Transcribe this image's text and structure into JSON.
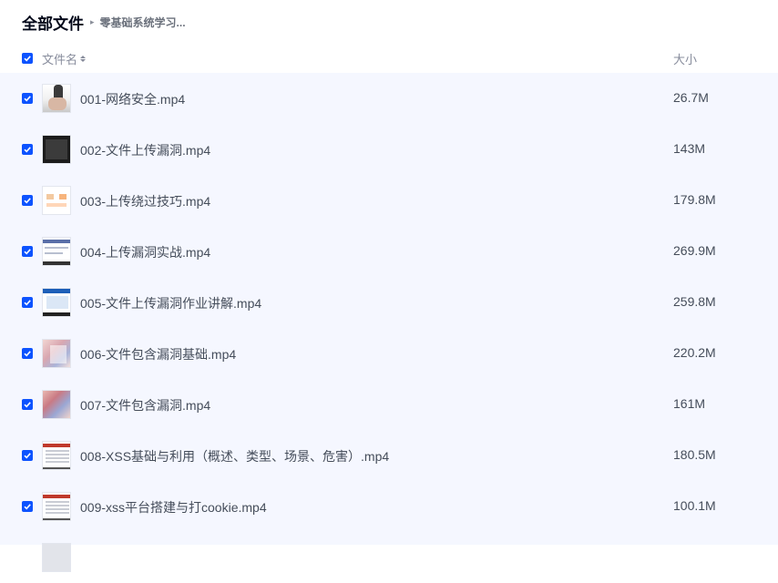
{
  "breadcrumb": {
    "root": "全部文件",
    "separator": "▸",
    "current": "零基础系统学习..."
  },
  "header": {
    "name_label": "文件名",
    "size_label": "大小",
    "select_all_checked": true
  },
  "colors": {
    "accent": "#0d53ff",
    "list_background": "#f5f7ff",
    "text": "#454d5a",
    "muted": "#878c9c"
  },
  "files": [
    {
      "name": "001-网络安全.mp4",
      "size": "26.7M",
      "checked": true,
      "thumbnail": "hand"
    },
    {
      "name": "002-文件上传漏洞.mp4",
      "size": "143M",
      "checked": true,
      "thumbnail": "dark"
    },
    {
      "name": "003-上传绕过技巧.mp4",
      "size": "179.8M",
      "checked": true,
      "thumbnail": "slide"
    },
    {
      "name": "004-上传漏洞实战.mp4",
      "size": "269.9M",
      "checked": true,
      "thumbnail": "browser"
    },
    {
      "name": "005-文件上传漏洞作业讲解.mp4",
      "size": "259.8M",
      "checked": true,
      "thumbnail": "blue"
    },
    {
      "name": "006-文件包含漏洞基础.mp4",
      "size": "220.2M",
      "checked": true,
      "thumbnail": "pink"
    },
    {
      "name": "007-文件包含漏洞.mp4",
      "size": "161M",
      "checked": true,
      "thumbnail": "pink2"
    },
    {
      "name": "008-XSS基础与利用（概述、类型、场景、危害）.mp4",
      "size": "180.5M",
      "checked": true,
      "thumbnail": "table"
    },
    {
      "name": "009-xss平台搭建与打cookie.mp4",
      "size": "100.1M",
      "checked": true,
      "thumbnail": "table"
    }
  ]
}
